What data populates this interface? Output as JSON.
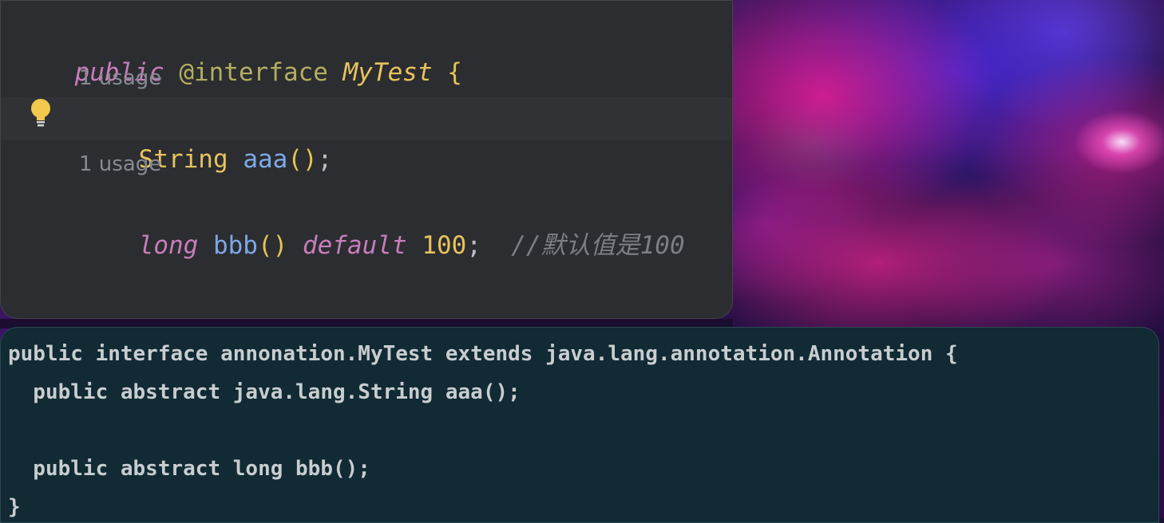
{
  "editor": {
    "lines": {
      "l1": {
        "kw": "public",
        "ann": "@interface",
        "cls": "MyTest",
        "brace": "{"
      },
      "usage1": "1 usage",
      "l2": {
        "type": "String",
        "method": "aaa",
        "paren": "()",
        "semi": ";"
      },
      "usage2": "1 usage",
      "l3": {
        "kw": "long",
        "method": "bbb",
        "paren": "()",
        "kw2": "default",
        "num": "100",
        "semi": ";",
        "comment": "//默认值是100"
      },
      "l4": {
        "brace": "}"
      }
    },
    "icons": {
      "bulb": "lightbulb-icon"
    }
  },
  "bytecode": {
    "lines": [
      "public interface annonation.MyTest extends java.lang.annotation.Annotation {",
      "  public abstract java.lang.String aaa();",
      "",
      "  public abstract long bbb();",
      "}"
    ]
  },
  "colors": {
    "keyword": "#c77dbb",
    "type": "#e8c35d",
    "method": "#7ea8e8",
    "comment": "#7a7e85",
    "editor_bg": "#2b2d30",
    "panel_bg": "#112a33"
  }
}
